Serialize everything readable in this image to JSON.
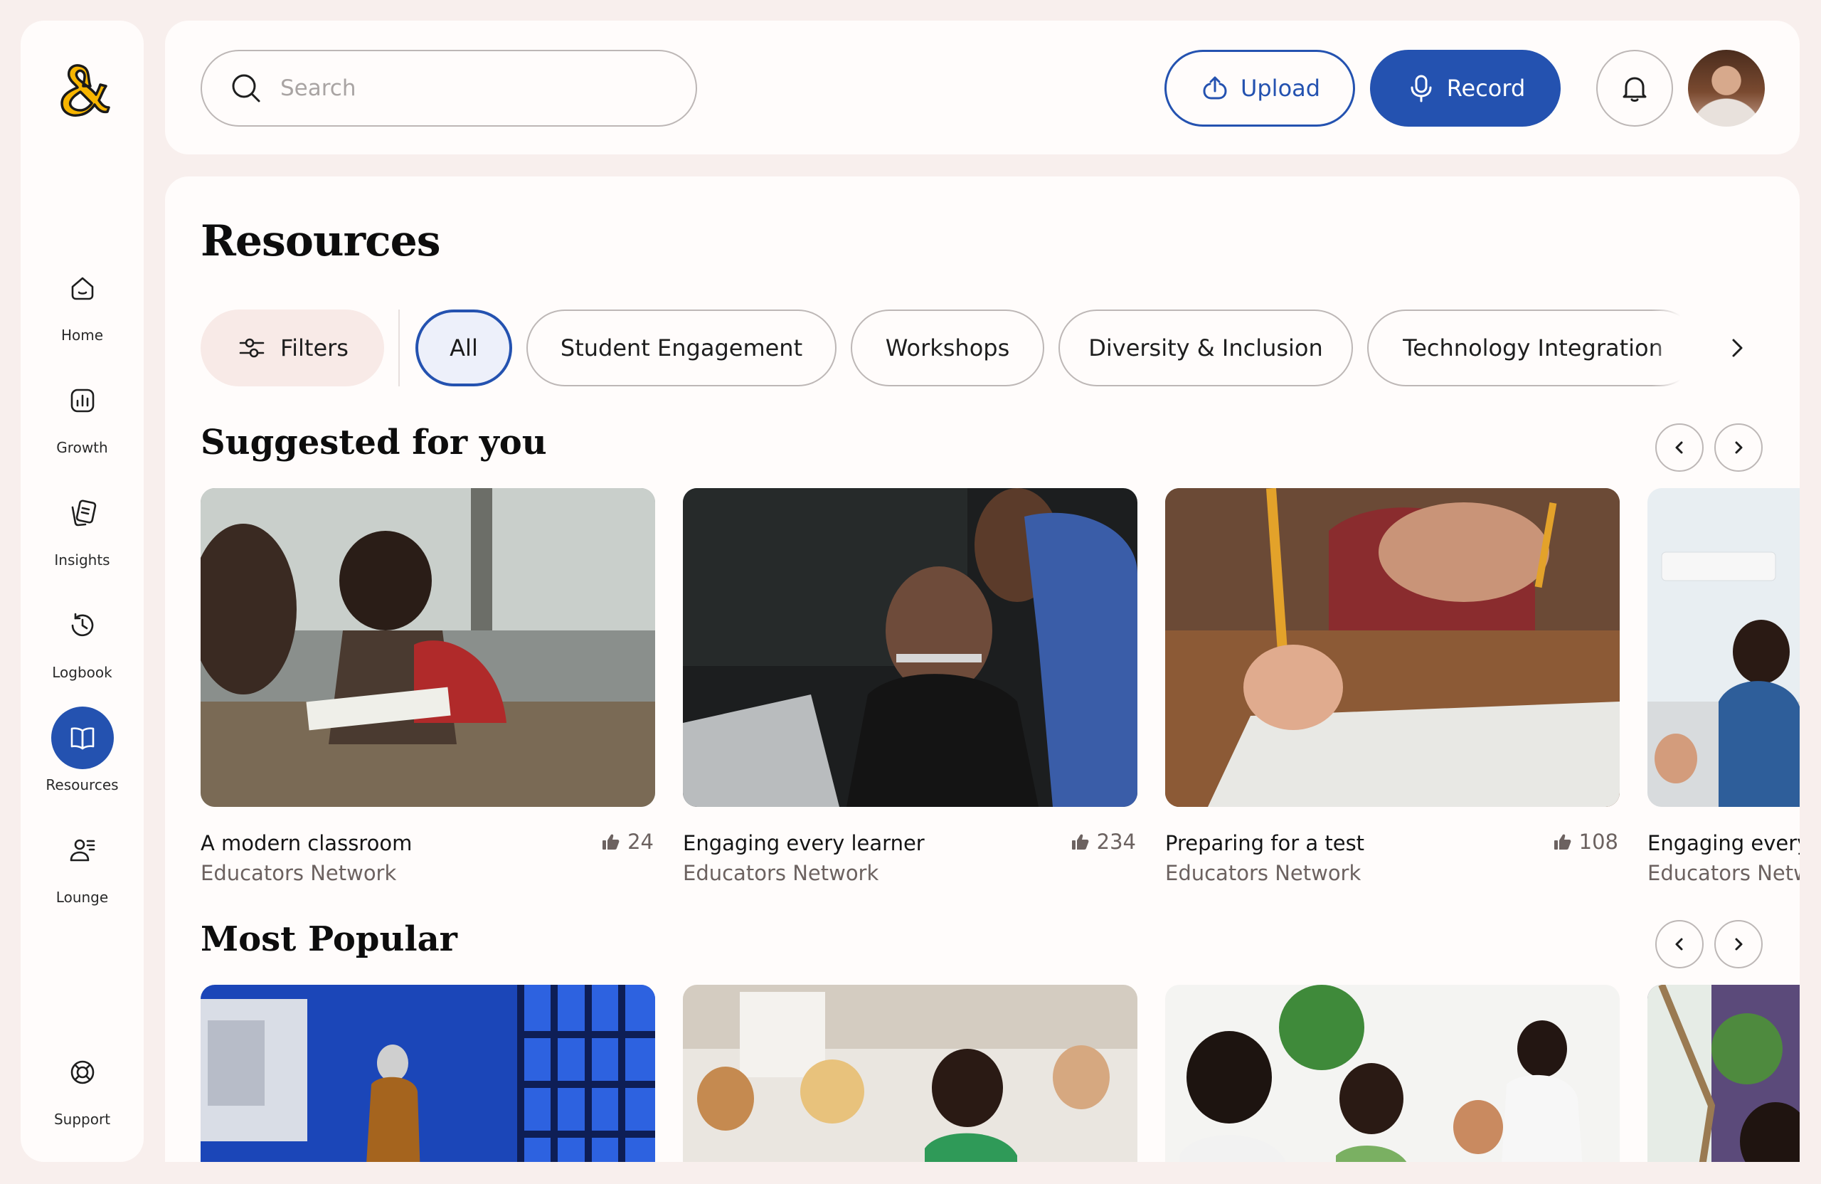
{
  "sidebar": {
    "logo_icon": "ampersand-logo",
    "items": [
      {
        "label": "Home",
        "icon": "home-icon"
      },
      {
        "label": "Growth",
        "icon": "growth-chart-icon"
      },
      {
        "label": "Insights",
        "icon": "insights-notes-icon"
      },
      {
        "label": "Logbook",
        "icon": "clock-history-icon"
      },
      {
        "label": "Resources",
        "icon": "book-open-icon",
        "active": true
      },
      {
        "label": "Lounge",
        "icon": "user-list-icon"
      }
    ],
    "support": {
      "label": "Support",
      "icon": "lifebuoy-icon"
    }
  },
  "header": {
    "search_placeholder": "Search",
    "upload_label": "Upload",
    "record_label": "Record",
    "bell_icon": "bell-icon",
    "avatar_icon": "user-avatar"
  },
  "page": {
    "title": "Resources",
    "filters_label": "Filters",
    "chips": [
      "All",
      "Student Engagement",
      "Workshops",
      "Diversity & Inclusion",
      "Technology Integration"
    ],
    "selected_chip": "All"
  },
  "suggested": {
    "title": "Suggested for you",
    "cards": [
      {
        "title": "A modern classroom",
        "source": "Educators Network",
        "likes": "24"
      },
      {
        "title": "Engaging every learner",
        "source": "Educators Network",
        "likes": "234"
      },
      {
        "title": "Preparing for a test",
        "source": "Educators Network",
        "likes": "108"
      },
      {
        "title": "Engaging every",
        "source": "Educators Netw",
        "likes": ""
      }
    ]
  },
  "popular": {
    "title": "Most Popular"
  },
  "colors": {
    "background": "#f8efed",
    "panel": "#fffcfb",
    "accent": "#2452b0",
    "logo": "#f7b500",
    "muted_text": "#6c6260"
  }
}
